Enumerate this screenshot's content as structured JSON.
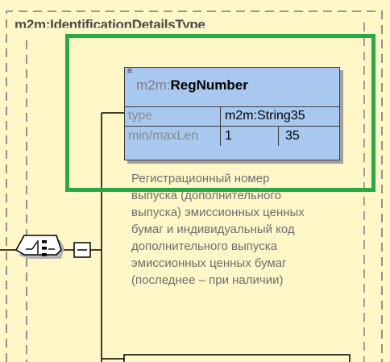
{
  "container": {
    "title": "m2m:IdentificationDetailsType"
  },
  "element": {
    "name_prefix": "m2m:",
    "name_local": "RegNumber",
    "properties": [
      {
        "key": "type",
        "values": [
          "m2m:String35"
        ]
      },
      {
        "key": "min/maxLen",
        "values": [
          "1",
          "35"
        ]
      }
    ],
    "documentation": [
      "Регистрационный номер",
      "выпуска (дополнительного",
      "выпуска) эмиссионных ценных",
      "бумаг и индивидуальный код",
      "дополнительного выпуска",
      "эмиссионных ценных бумаг",
      "(последнее – при наличии)"
    ]
  },
  "colors": {
    "canvas_background": "#fff7c8",
    "element_fill": "#a8c8f0",
    "highlight_border": "#29a847"
  },
  "icons": [
    "sequence-compositor-icon",
    "collapse-minus-icon",
    "element-menu-icon"
  ]
}
